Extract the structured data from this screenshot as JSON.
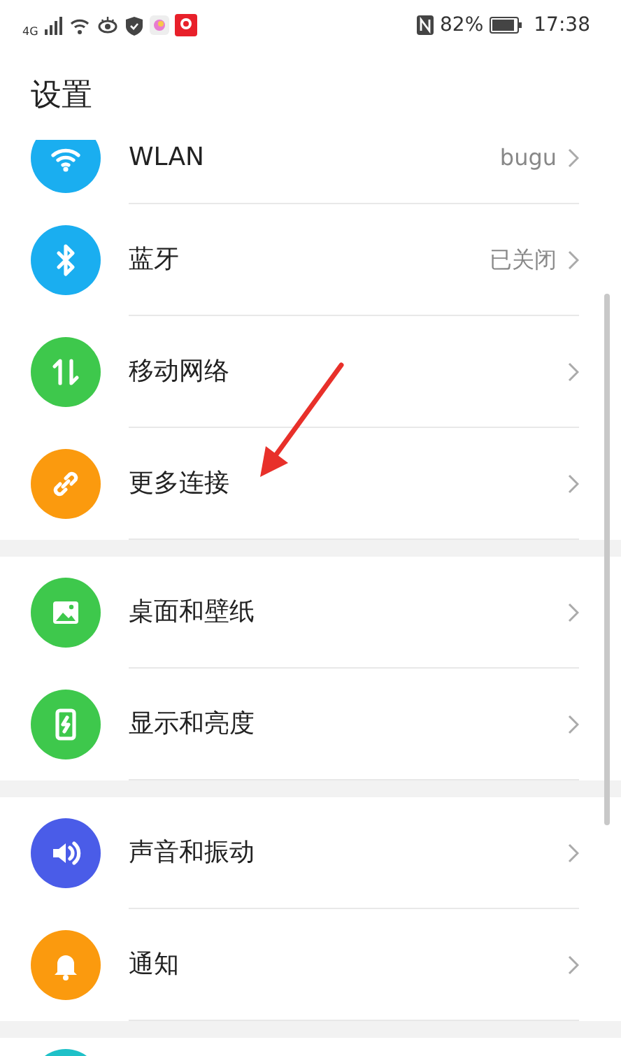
{
  "status_bar": {
    "network": "4G",
    "battery": "82%",
    "time": "17:38"
  },
  "title": "设置",
  "groups": [
    {
      "items": [
        {
          "label": "WLAN",
          "value": "bugu",
          "color": "#1aaef0"
        },
        {
          "label": "蓝牙",
          "value": "已关闭",
          "color": "#1aaef0"
        },
        {
          "label": "移动网络",
          "color": "#3ec84c"
        },
        {
          "label": "更多连接",
          "color": "#fb9a0e"
        }
      ]
    },
    {
      "items": [
        {
          "label": "桌面和壁纸",
          "color": "#3ec84c"
        },
        {
          "label": "显示和亮度",
          "color": "#3ec84c"
        }
      ]
    },
    {
      "items": [
        {
          "label": "声音和振动",
          "color": "#4a5ce8"
        },
        {
          "label": "通知",
          "color": "#fb9a0e"
        }
      ]
    },
    {
      "items": [
        {
          "color": "#1fc1c8"
        }
      ]
    }
  ]
}
